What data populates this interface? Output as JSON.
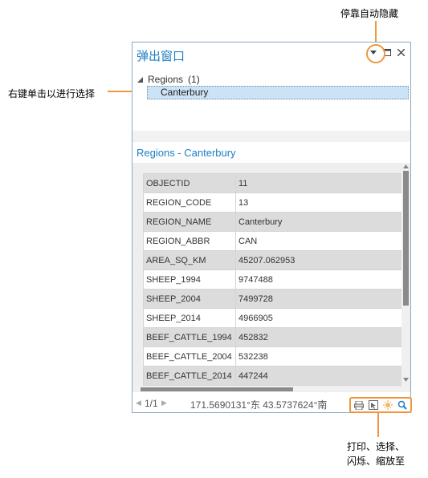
{
  "callouts": {
    "auto_hide": "停靠自动隐藏",
    "right_click": "右键单击以进行选择",
    "tools_line1": "打印、选择、",
    "tools_line2": "闪烁、缩放至"
  },
  "panel": {
    "title": "弹出窗口",
    "tree": {
      "layer": "Regions",
      "count": "(1)",
      "selected": "Canterbury"
    },
    "subtitle": "Regions - Canterbury",
    "rows": [
      {
        "k": "OBJECTID",
        "v": "11"
      },
      {
        "k": "REGION_CODE",
        "v": "13"
      },
      {
        "k": "REGION_NAME",
        "v": "Canterbury"
      },
      {
        "k": "REGION_ABBR",
        "v": "CAN"
      },
      {
        "k": "AREA_SQ_KM",
        "v": "45207.062953"
      },
      {
        "k": "SHEEP_1994",
        "v": "9747488"
      },
      {
        "k": "SHEEP_2004",
        "v": "7499728"
      },
      {
        "k": "SHEEP_2014",
        "v": "4966905"
      },
      {
        "k": "BEEF_CATTLE_1994",
        "v": "452832"
      },
      {
        "k": "BEEF_CATTLE_2004",
        "v": "532238"
      },
      {
        "k": "BEEF_CATTLE_2014",
        "v": "447244"
      }
    ],
    "status": {
      "page": "1/1",
      "coords": "171.5690131°东 43.5737624°南"
    }
  },
  "icons": [
    "dropdown-icon",
    "maximize-icon",
    "close-icon",
    "print-icon",
    "select-icon",
    "flash-icon",
    "zoom-icon"
  ],
  "colors": {
    "accent": "#1b7fc4",
    "callout": "#f0963c",
    "selection": "#cce3f6"
  }
}
